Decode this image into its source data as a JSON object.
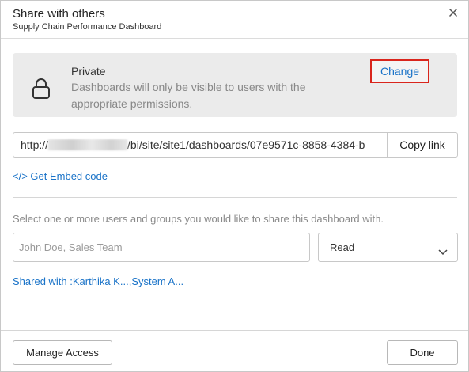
{
  "header": {
    "title": "Share with others",
    "subtitle": "Supply Chain Performance Dashboard",
    "close_icon": "close-icon"
  },
  "privacy": {
    "title": "Private",
    "description": "Dashboards will only be visible to users with the appropriate permissions.",
    "change_label": "Change",
    "icon": "lock-icon",
    "change_highlight_color": "#d9251c"
  },
  "link": {
    "url_prefix": "http://",
    "url_suffix": "/bi/site/site1/dashboards/07e9571c-8858-4384-b",
    "copy_label": "Copy link"
  },
  "embed": {
    "label": "</> Get Embed code"
  },
  "share": {
    "description": "Select one or more users and groups you would like to share this dashboard with.",
    "placeholder": "John Doe, Sales Team",
    "permission": "Read",
    "shared_with_prefix": "Shared with :",
    "shared_with": [
      "Karthika K...",
      "System A..."
    ]
  },
  "footer": {
    "manage_label": "Manage Access",
    "done_label": "Done"
  },
  "colors": {
    "link": "#1a73c8",
    "panel": "#ebebeb"
  }
}
